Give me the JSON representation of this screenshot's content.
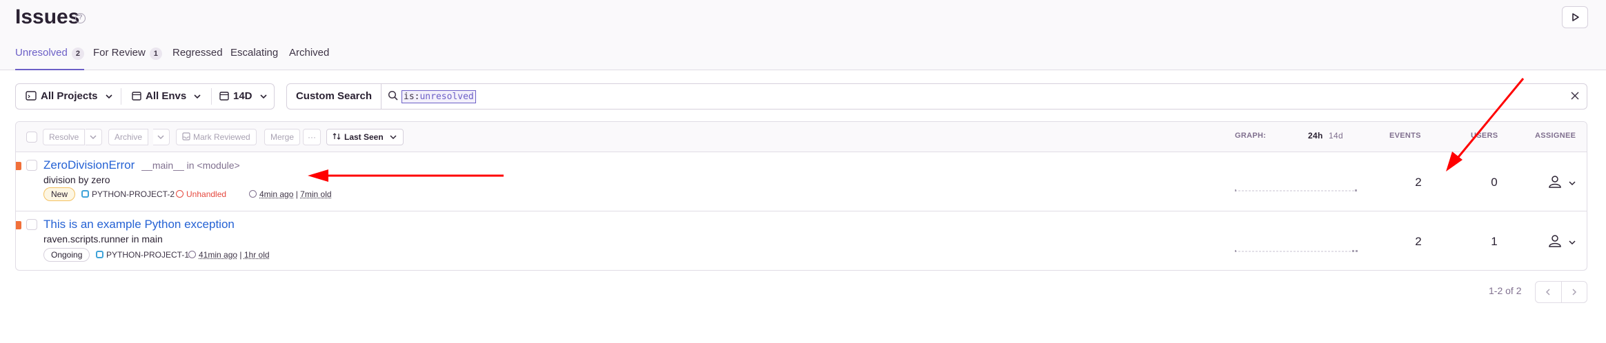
{
  "header": {
    "title": "Issues",
    "tabs": [
      {
        "label": "Unresolved",
        "badge": "2"
      },
      {
        "label": "For Review",
        "badge": "1"
      },
      {
        "label": "Regressed",
        "badge": ""
      },
      {
        "label": "Escalating",
        "badge": ""
      },
      {
        "label": "Archived",
        "badge": ""
      }
    ]
  },
  "filters": {
    "projects": "All Projects",
    "envs": "All Envs",
    "period": "14D",
    "custom_search": "Custom Search",
    "query_key": "is:",
    "query_value": "unresolved"
  },
  "table": {
    "actions": {
      "resolve": "Resolve",
      "archive": "Archive",
      "mark_reviewed": "Mark Reviewed",
      "merge": "Merge",
      "more": "···",
      "sort": "Last Seen"
    },
    "columns": {
      "graph": "GRAPH:",
      "graph_24h": "24h",
      "graph_14d": "14d",
      "events": "EVENTS",
      "users": "USERS",
      "assignee": "ASSIGNEE"
    },
    "rows": [
      {
        "title": "ZeroDivisionError",
        "location": "__main__ in <module>",
        "message": "division by zero",
        "status": "New",
        "project": "PYTHON-PROJECT-2",
        "handled": "Unhandled",
        "last_seen": "4min ago",
        "age": "7min old",
        "events": "2",
        "users": "0"
      },
      {
        "title": "This is an example Python exception",
        "location": "",
        "message": "raven.scripts.runner in main",
        "status": "Ongoing",
        "project": "PYTHON-PROJECT-1",
        "handled": "",
        "last_seen": "41min ago",
        "age": "1hr old",
        "events": "2",
        "users": "1"
      }
    ]
  },
  "pagination": {
    "info": "1-2 of 2"
  },
  "colors": {
    "accent": "#6c5fc7",
    "link": "#2562d4",
    "level_error": "#f1703a",
    "annotation_arrow": "#ff0000"
  }
}
